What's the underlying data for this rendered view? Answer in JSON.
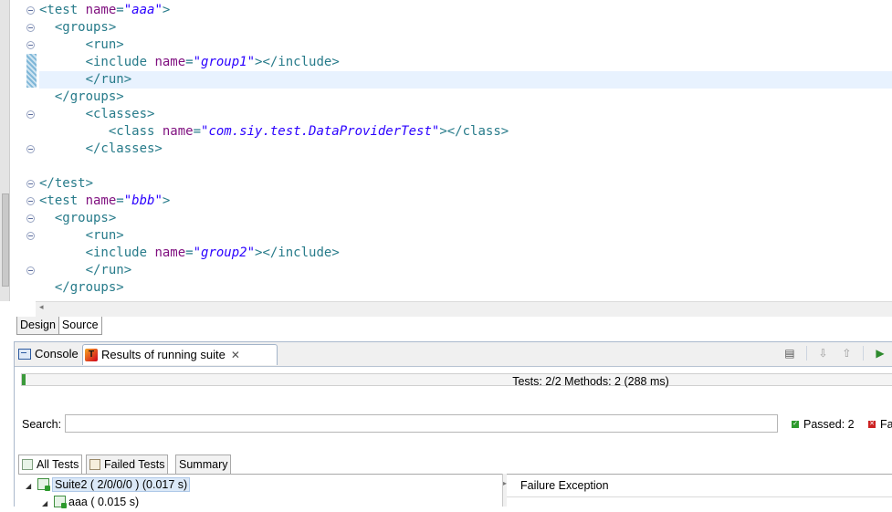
{
  "editor": {
    "lines": [
      [
        {
          "t": "<test ",
          "c": "tg"
        },
        {
          "t": "name",
          "c": "an"
        },
        {
          "t": "=",
          "c": "tg"
        },
        {
          "t": "\"aaa\"",
          "c": "av"
        },
        {
          "t": ">",
          "c": "tg"
        }
      ],
      [
        {
          "t": "  <groups>",
          "c": "tg"
        }
      ],
      [
        {
          "t": "      <run>",
          "c": "tg"
        }
      ],
      [
        {
          "t": "      <include ",
          "c": "tg"
        },
        {
          "t": "name",
          "c": "an"
        },
        {
          "t": "=",
          "c": "tg"
        },
        {
          "t": "\"group1\"",
          "c": "av"
        },
        {
          "t": "></include>",
          "c": "tg"
        }
      ],
      [
        {
          "t": "      </run>",
          "c": "tg"
        }
      ],
      [
        {
          "t": "  </groups>",
          "c": "tg"
        }
      ],
      [
        {
          "t": "      <classes>",
          "c": "tg"
        }
      ],
      [
        {
          "t": "         <class ",
          "c": "tg"
        },
        {
          "t": "name",
          "c": "an"
        },
        {
          "t": "=",
          "c": "tg"
        },
        {
          "t": "\"com.siy.test.DataProviderTest\"",
          "c": "av"
        },
        {
          "t": "></class>",
          "c": "tg"
        }
      ],
      [
        {
          "t": "      </classes>",
          "c": "tg"
        }
      ],
      [],
      [
        {
          "t": "</test>",
          "c": "tg"
        }
      ],
      [
        {
          "t": "<test ",
          "c": "tg"
        },
        {
          "t": "name",
          "c": "an"
        },
        {
          "t": "=",
          "c": "tg"
        },
        {
          "t": "\"bbb\"",
          "c": "av"
        },
        {
          "t": ">",
          "c": "tg"
        }
      ],
      [
        {
          "t": "  <groups>",
          "c": "tg"
        }
      ],
      [
        {
          "t": "      <run>",
          "c": "tg"
        }
      ],
      [
        {
          "t": "      <include ",
          "c": "tg"
        },
        {
          "t": "name",
          "c": "an"
        },
        {
          "t": "=",
          "c": "tg"
        },
        {
          "t": "\"group2\"",
          "c": "av"
        },
        {
          "t": "></include>",
          "c": "tg"
        }
      ],
      [
        {
          "t": "      </run>",
          "c": "tg"
        }
      ],
      [
        {
          "t": "  </groups>",
          "c": "tg"
        }
      ]
    ],
    "highlighted_line": 4,
    "fold_markers": [
      0,
      1,
      2,
      6,
      8,
      10,
      11,
      12,
      13,
      15
    ],
    "mode_tabs": [
      "Design",
      "Source"
    ],
    "active_mode_tab": "Source"
  },
  "view": {
    "tabs": {
      "console": "Console",
      "results": "Results of running suite"
    },
    "toolbar_icons": [
      "history-icon",
      "next-failure-icon",
      "previous-failure-icon",
      "rerun-icon"
    ],
    "progress_fraction": 0.004,
    "summary": "Tests: 2/2  Methods: 2 (288 ms)",
    "search": {
      "label": "Search:",
      "value": ""
    },
    "passed_label": "Passed: 2",
    "failed_label": "Fa",
    "result_tabs": [
      "All Tests",
      "Failed Tests",
      "Summary"
    ],
    "tree": [
      {
        "label": "Suite2 ( 2/0/0/0 ) (0.017 s)",
        "level": 0,
        "selected": true
      },
      {
        "label": "aaa ( 0.015 s)",
        "level": 1,
        "selected": false
      }
    ],
    "failure_header": "Failure Exception"
  }
}
